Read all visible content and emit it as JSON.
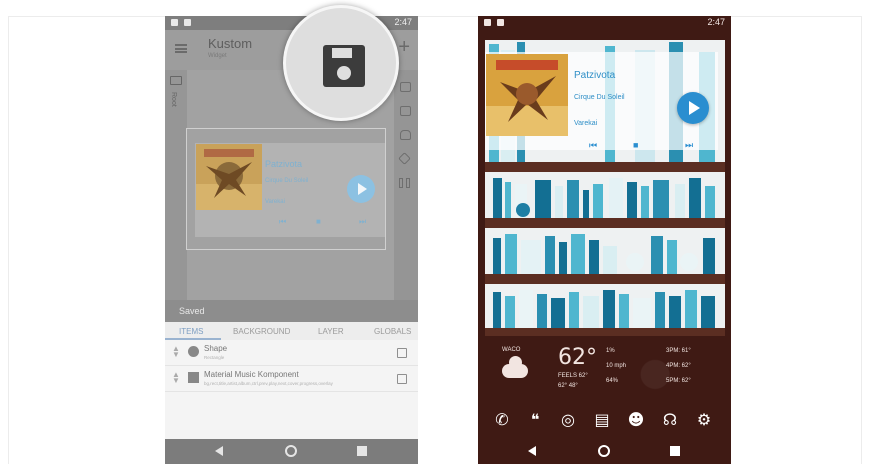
{
  "left_phone": {
    "status_time": "2:47",
    "app_title": "Kustom",
    "app_subtitle": "Widget",
    "rail_label": "Root",
    "widget": {
      "title": "Patzivota",
      "artist": "Cirque Du Soleil",
      "album": "Varekai"
    },
    "toast": "Saved",
    "tabs": [
      "ITEMS",
      "BACKGROUND",
      "LAYER",
      "GLOBALS"
    ],
    "items": [
      {
        "name": "Shape",
        "sub": "Rectangle"
      },
      {
        "name": "Material Music Komponent",
        "sub": "bg,rect,title,artist,album,ctrl,prev,play,next,cover,progress,overlay"
      }
    ]
  },
  "right_phone": {
    "status_time": "2:47",
    "player": {
      "title": "Patzivota",
      "artist": "Cirque Du Soleil",
      "album": "Varekai"
    },
    "weather": {
      "city": "WACO",
      "temp": "62°",
      "feels": "FEELS 62°",
      "hilo": "62° 48°",
      "stats": [
        "1%",
        "10 mph",
        "64%"
      ],
      "forecast": [
        "3PM: 61°",
        "4PM: 62°",
        "5PM: 62°"
      ]
    },
    "dock_icons": [
      "phone-icon",
      "hangouts-icon",
      "chrome-icon",
      "books-icon",
      "android-icon",
      "headphones-icon",
      "settings-icon"
    ]
  },
  "colors": {
    "accent_blue": "#2a8ed0",
    "wood": "#5b2e22",
    "wallpaper": "#3f1a14"
  }
}
